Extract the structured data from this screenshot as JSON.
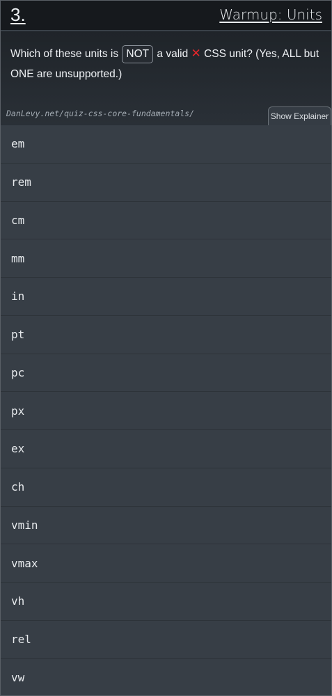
{
  "header": {
    "number": "3.",
    "title": "Warmup: Units"
  },
  "question": {
    "part1": "Which of these units is ",
    "highlight": "NOT",
    "part2": " a valid ",
    "icon": "red-cross-icon",
    "part3": " CSS unit? (Yes, ALL but ONE are unsupported.)"
  },
  "source_link": "DanLevy.net/quiz-css-core-fundamentals/",
  "explainer_button": "Show Explainer",
  "options": [
    "em",
    "rem",
    "cm",
    "mm",
    "in",
    "pt",
    "pc",
    "px",
    "ex",
    "ch",
    "vmin",
    "vmax",
    "vh",
    "rel",
    "vw"
  ],
  "colors": {
    "header_bg": "#16191d",
    "option_bg": "#373e46",
    "cross": "#e8262a"
  }
}
